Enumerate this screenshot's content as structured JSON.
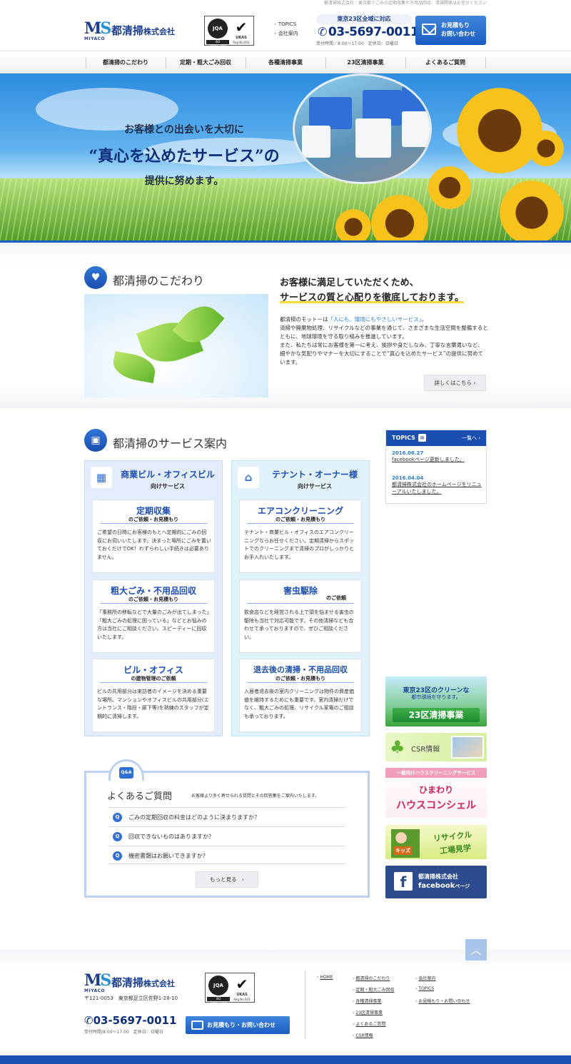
{
  "top_note": "都清掃株式会社｜東京都でごみの定期収集や不用品回収、清掃関係はお任せください",
  "header": {
    "logo_mark_m": "M",
    "logo_mark_s": "S",
    "logo_sub": "MIYACO",
    "company": "都清掃",
    "company_suffix": "株式会社",
    "cert": {
      "circle": "JQA",
      "ukas": "UKAS",
      "iso": "ISO 14001:2004",
      "reg": "Reg No.003"
    },
    "links": [
      "TOPICS",
      "会社案内"
    ],
    "area": "東京23区全域に対応",
    "phone": "03-5697-0011",
    "hours": "受付時間／8:00～17:00　定休日：日曜日",
    "contact_line1": "お見積もり",
    "contact_line2": "お問い合わせ"
  },
  "nav": [
    "都清掃のこだわり",
    "定期・粗大ごみ回収",
    "各種清掃事業",
    "23区清掃事業",
    "よくあるご質問"
  ],
  "hero": {
    "line1": "お客様との出会いを大切に",
    "line2": "“真心を込めたサービス”の",
    "line3": "提供に努めます。"
  },
  "kodawari": {
    "title": "都清掃のこだわり",
    "headline1": "お客様に満足していただくため、",
    "headline2": "サービスの質と心配りを徹底しております。",
    "p1a": "都清掃のモットーは",
    "p1b": "「人にも、環境にもやさしいサービス」",
    "p1c": "。",
    "p2": "清掃や廃棄物処理、リサイクルなどの事業を通じて、さまざまな生活空間を整備するとともに、地球環境を守る取り組みを推進しています。",
    "p3": "また、私たちは常にお客様を第一に考え、挨拶や身だしなみ、丁寧な言葉遣いなど、細やかな気配りやマナーを大切にすることで“真心を込めたサービス”の提供に努めています。",
    "more": "詳しくはこちら"
  },
  "services": {
    "title": "都清掃のサービス案内",
    "box1": {
      "t1": "商業ビル・オフィスビル",
      "t2": "向けサービス",
      "cards": [
        {
          "title": "定期収集",
          "sub": "のご依頼・お見積もり",
          "body": "ご希望の日時にお客様のもとへ定期的にごみの回収にお伺いいたします。決まった場所にごみを置いておくだけでOK！わずらわしい手続きは必要ありません。"
        },
        {
          "title": "粗大ごみ・不用品回収",
          "sub": "のご依頼・お見積もり",
          "body": "「事務所の移転などで大量のごみが出てしまった」「粗大ごみの処理に困っている」などとお悩みの方は当社にご相談ください。スピーディーに回収いたします。"
        },
        {
          "title": "ビル・オフィス",
          "sub": "の建物管理のご依頼",
          "body": "ビルの共用部分は来訪者のイメージを決める重要な場所。マンションやオフィスビルの共用部分(エントランス・階段・廊下等)を熟練のスタッフが定期的に清掃します。"
        }
      ]
    },
    "box2": {
      "t1": "テナント・オーナー様",
      "t2": "向けサービス",
      "cards": [
        {
          "title": "エアコンクリーニング",
          "sub": "のご依頼・お見積もり",
          "body": "テナント・商業ビル・オフィスのエアコンクリーニングならお任せください。定期清掃からスポットでのクリーニングまで清掃のプロがしっかりとお手入れいたします。"
        },
        {
          "title": "害虫駆除",
          "sub": "のご依頼",
          "body": "飲食店などを経営される上で頭を悩ませる害虫の駆除も当社で対応可能です。その他清掃なども合わせて承っておりますので、ぜひご相談ください。"
        },
        {
          "title": "退去後の清掃・不用品回収",
          "sub": "のご依頼・お見積もり",
          "body": "入居者退去後の室内クリーニングは物件の資産価値を維持するためにも重要です。室内清掃だけでなく、粗大ごみの処理、リサイクル家電のご相談も承っております。"
        }
      ]
    }
  },
  "topics": {
    "title": "TOPICS",
    "more": "一覧へ",
    "items": [
      {
        "date": "2016.06.27",
        "text": "facebookページ更新しました。"
      },
      {
        "date": "2016.04.04",
        "text": "都清掃株式会社のホームページをリニューアルいたしました。"
      }
    ]
  },
  "banners": {
    "b1_a": "東京23区のクリーンな",
    "b1_b": "都市環境を守ります。",
    "b1_c": "23区清掃事業",
    "b2": "CSR情報",
    "b3_top": "一般向けハウスクリーニングサービス",
    "b3_a": "ひまわり",
    "b3_b": "ハウスコンシェル",
    "b4_k": "キッズ",
    "b4_a": "リサイクル",
    "b4_b": "工場見学",
    "b5_a": "都清掃株式会社",
    "b5_b": "facebook",
    "b5_c": "ページ"
  },
  "faq": {
    "tab": "Q&A",
    "title": "よくあるご質問",
    "desc": "お客様より多く寄せられる質問とその回答集をご案内いたします。",
    "q": [
      "ごみの定期回収の料金はどのように決まりますか？",
      "回収できないものはありますか？",
      "機密書類はお願いできますか？"
    ],
    "more": "もっと見る"
  },
  "footer": {
    "address": "〒121-0053　東京都足立区佐野1-28-10",
    "phone": "03-5697-0011",
    "hours": "受付時間/8:00～17:00　定休日：日曜日",
    "contact": "お見積もり・お問い合わせ",
    "links_col1": [
      "HOME"
    ],
    "links_col2": [
      "都清掃のこだわり",
      "定期・粗大ごみ回収",
      "各種清掃事業",
      "23区清掃事業",
      "よくあるご質問",
      "CSR情報"
    ],
    "links_col3": [
      "会社案内",
      "TOPICS",
      "お見積もり・お問い合わせ"
    ]
  },
  "colors": {
    "brand": "#1c3f8f",
    "accent": "#1b5cc2",
    "link": "#2a7fd1"
  }
}
